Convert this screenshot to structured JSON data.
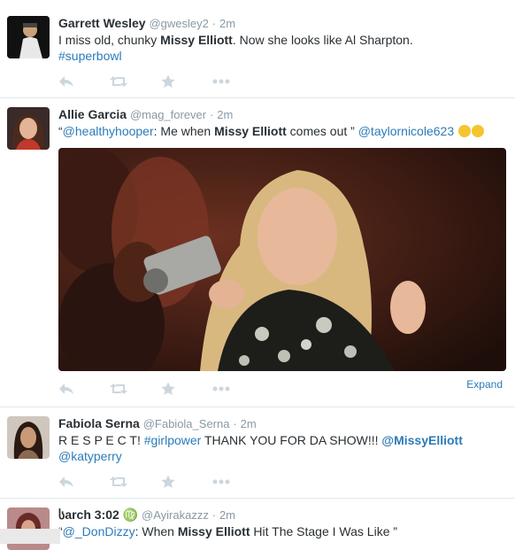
{
  "tweets": [
    {
      "name": "Garrett Wesley",
      "handle": "@gwesley2",
      "time": "2m",
      "text_a": "I miss old, chunky ",
      "text_b": "Missy Elliott",
      "text_c": ". Now she looks like Al Sharpton.",
      "hashtag": "#superbowl"
    },
    {
      "name": "Allie Garcia",
      "handle": "@mag_forever",
      "time": "2m",
      "quote_open": "“",
      "mention1": "@healthyhooper",
      "text_a": ": Me when ",
      "text_b": "Missy Elliott",
      "text_c": " comes out ” ",
      "mention2": "@taylornicole623",
      "expand": "Expand"
    },
    {
      "name": "Fabiola Serna",
      "handle": "@Fabiola_Serna",
      "time": "2m",
      "text_a": "R E S P E C T! ",
      "hashtag": "#girlpower",
      "text_b": " THANK YOU FOR DA SHOW!!!  ",
      "mention1": "@MissyElliott",
      "mention2": "@katyperry"
    },
    {
      "name": "სarch 3:02 ♍",
      "handle": "@Ayirakazzz",
      "time": "2m",
      "quote_open": "“",
      "mention1": "@_DonDizzy",
      "text_a": ": When ",
      "text_b": "Missy Elliott",
      "text_c": " Hit The Stage I Was Like ”"
    }
  ],
  "separator": "·",
  "icons": [
    "reply-icon",
    "retweet-icon",
    "favorite-icon",
    "more-icon"
  ],
  "colors": {
    "link": "#2b7bb9",
    "meta": "#8899a6",
    "icon": "#ccd6dd"
  }
}
